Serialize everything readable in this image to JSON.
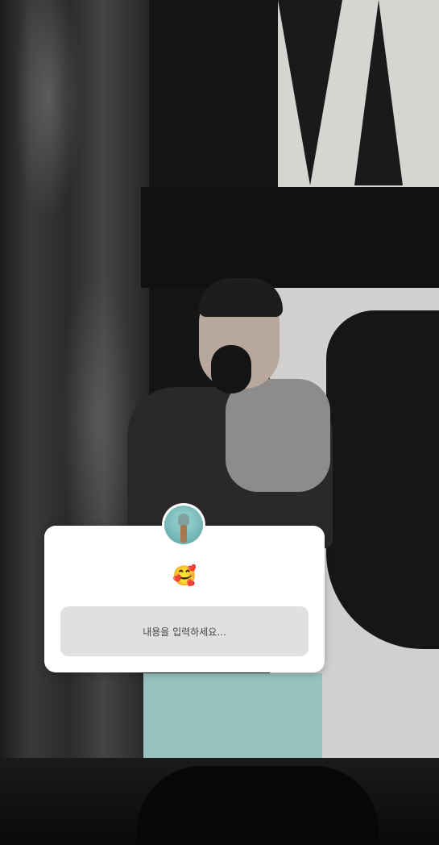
{
  "sticker": {
    "emoji": "🥰",
    "input_placeholder": "내용을 입력하세요..."
  },
  "icons": {
    "avatar": "profile-avatar-icon"
  }
}
